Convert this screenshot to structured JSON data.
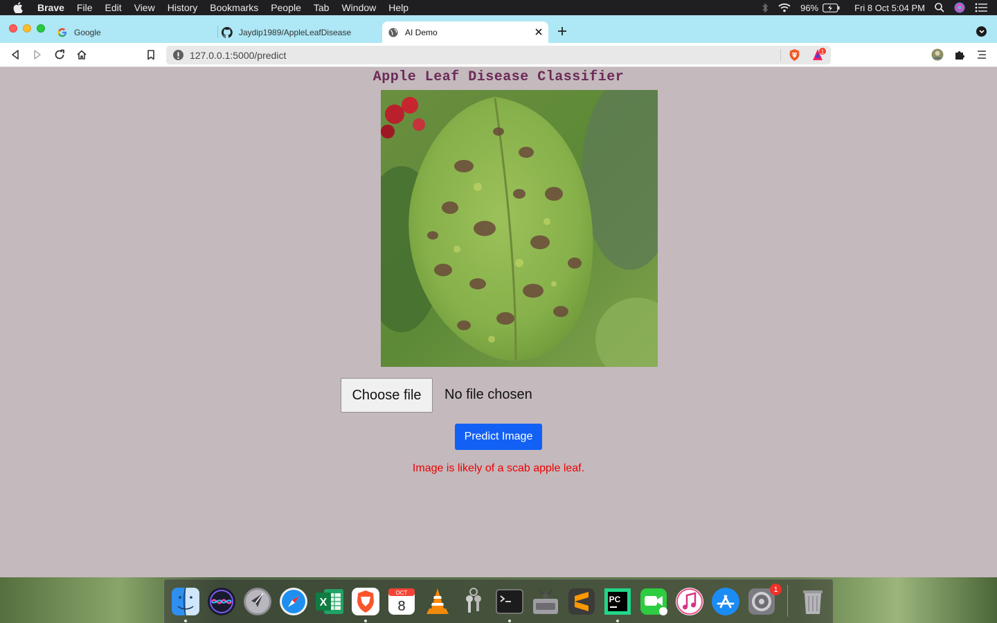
{
  "menubar": {
    "app_name": "Brave",
    "items": [
      "File",
      "Edit",
      "View",
      "History",
      "Bookmarks",
      "People",
      "Tab",
      "Window",
      "Help"
    ],
    "battery": "96%",
    "datetime": "Fri 8 Oct  5:04 PM"
  },
  "tabs": [
    {
      "title": "Google",
      "icon": "google-icon"
    },
    {
      "title": "Jaydip1989/AppleLeafDisease",
      "icon": "github-icon"
    },
    {
      "title": "AI Demo",
      "icon": "globe-icon",
      "active": true
    }
  ],
  "toolbar": {
    "url": "127.0.0.1:5000/predict",
    "rewards_badge": "1"
  },
  "page": {
    "title": "Apple Leaf Disease Classifier",
    "file_button": "Choose file",
    "file_status": "No file chosen",
    "predict_button": "Predict Image",
    "result": "Image is likely of a scab apple leaf.",
    "result_color": "#ee0000",
    "title_color": "#6b2a58",
    "background_color": "#c4b9bd",
    "button_color": "#1261f4"
  },
  "dock": {
    "apps": [
      "Finder",
      "Siri",
      "Launchpad",
      "Safari",
      "Microsoft Excel",
      "Brave Browser",
      "Calendar",
      "VLC",
      "Keychain Access",
      "Terminal",
      "Disk Utility",
      "Sublime Text",
      "PyCharm",
      "FaceTime",
      "iTunes",
      "App Store",
      "System Preferences",
      "Trash"
    ],
    "calendar_month": "OCT",
    "calendar_day": "8",
    "prefs_badge": "1"
  }
}
